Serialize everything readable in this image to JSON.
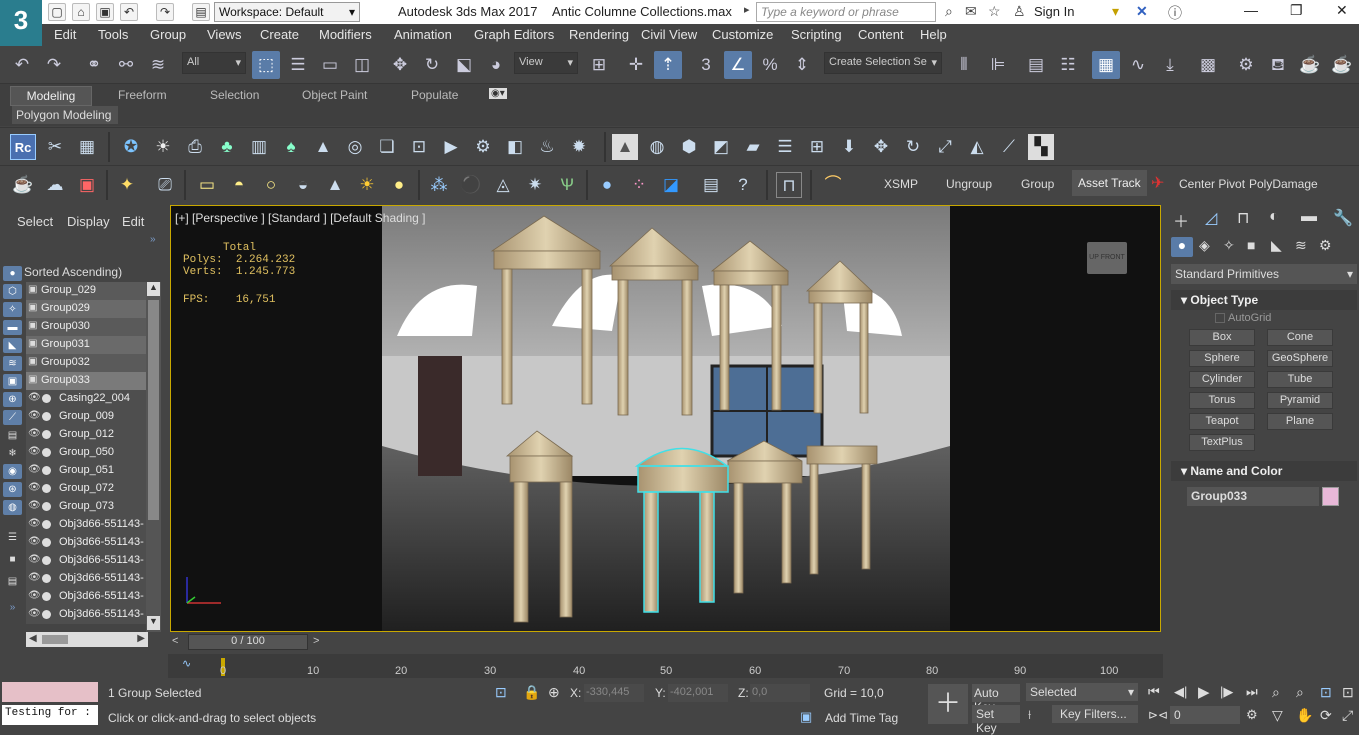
{
  "titlebar": {
    "logo_text": "3",
    "workspace": "Workspace: Default",
    "app_title": "Autodesk 3ds Max 2017",
    "file_name": "Antic Columne Collections.max",
    "search_placeholder": "Type a keyword or phrase",
    "sign_in": "Sign In"
  },
  "menu": [
    "Edit",
    "Tools",
    "Group",
    "Views",
    "Create",
    "Modifiers",
    "Animation",
    "Graph Editors",
    "Rendering",
    "Civil View",
    "Customize",
    "Scripting",
    "Content",
    "Help"
  ],
  "main_toolbar": {
    "filter_value": "All",
    "ref_coord_value": "View",
    "selection_set_placeholder": "Create Selection Se"
  },
  "ribbon": {
    "tabs": [
      "Modeling",
      "Freeform",
      "Selection",
      "Object Paint",
      "Populate"
    ],
    "active_tab": "Modeling",
    "panel_label": "Polygon Modeling"
  },
  "toolbar3_labels": [
    "XSMP",
    "Ungroup",
    "Group",
    "Asset Track",
    "Center Pivot",
    "PolyDamage"
  ],
  "scene_explorer": {
    "tabs": [
      "Select",
      "Display",
      "Edit"
    ],
    "sort_label": "Sorted Ascending)",
    "rows": [
      "Group_029",
      "Group029",
      "Group030",
      "Group031",
      "Group032",
      "Group033",
      "Casing22_004",
      "Group_009",
      "Group_012",
      "Group_050",
      "Group_051",
      "Group_072",
      "Group_073",
      "Obj3d66-551143-",
      "Obj3d66-551143-",
      "Obj3d66-551143-",
      "Obj3d66-551143-",
      "Obj3d66-551143-",
      "Obj3d66-551143-"
    ]
  },
  "viewport": {
    "label": "[+] [Perspective ] [Standard ] [Default Shading ]",
    "stats": {
      "total_label": "Total",
      "polys_label": "Polys:",
      "polys": "2.264.232",
      "verts_label": "Verts:",
      "verts": "1.245.773",
      "fps_label": "FPS:",
      "fps": "16,751"
    },
    "viewcube_text": "UP FRONT"
  },
  "timeline": {
    "slider": "0 / 100",
    "ticks": [
      "0",
      "10",
      "20",
      "30",
      "40",
      "50",
      "60",
      "70",
      "80",
      "90",
      "100"
    ]
  },
  "status": {
    "maxscript_text": "Testing for :",
    "selected": "1 Group Selected",
    "prompt": "Click or click-and-drag to select objects",
    "x_label": "X:",
    "x": "-330,445",
    "y_label": "Y:",
    "y": "-402,001",
    "z_label": "Z:",
    "z": "0,0",
    "grid": "Grid = 10,0",
    "add_time_tag": "Add Time Tag",
    "auto_key": "Auto Key",
    "set_key": "Set Key",
    "key_mode": "Selected",
    "key_filters": "Key Filters...",
    "frame": "0"
  },
  "command_panel": {
    "category": "Standard Primitives",
    "object_type_title": "Object Type",
    "autogrid": "AutoGrid",
    "buttons": [
      "Box",
      "Cone",
      "Sphere",
      "GeoSphere",
      "Cylinder",
      "Tube",
      "Torus",
      "Pyramid",
      "Teapot",
      "Plane",
      "TextPlus"
    ],
    "name_color_title": "Name and Color",
    "object_name": "Group033",
    "object_color": "#e8b8d8"
  },
  "colors": {
    "accent": "#5a7ca8",
    "viewport_border": "#c8a800",
    "selection": "#40e0e8",
    "logo": "#2a7d8e"
  }
}
